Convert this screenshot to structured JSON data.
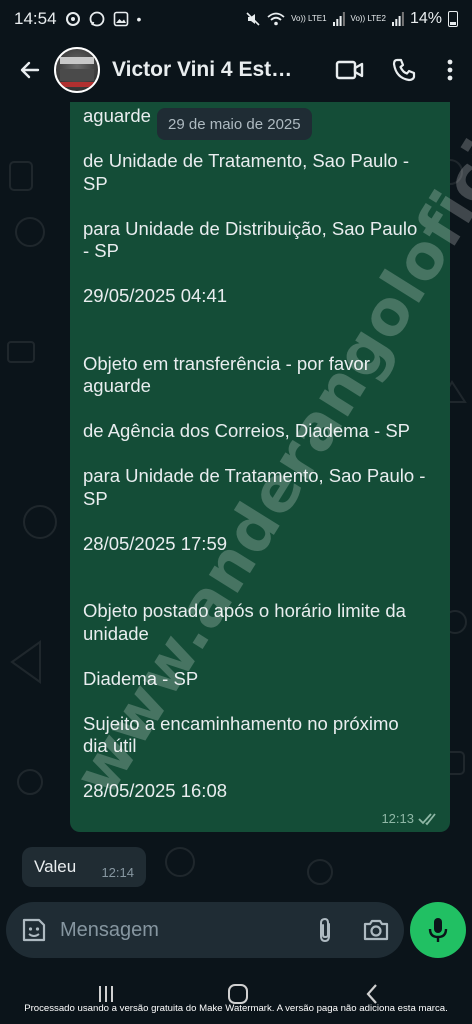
{
  "status_bar": {
    "time": "14:54",
    "net1": "Vo)) LTE1",
    "net2": "Vo)) LTE2",
    "battery": "14%"
  },
  "header": {
    "contact_name": "Victor Vini 4 Estre..."
  },
  "chat": {
    "date_chip": "29 de maio de 2025",
    "outgoing_message": "aguarde\n\nde Unidade de Tratamento, Sao Paulo -\nSP\n\npara Unidade de Distribuição, Sao Paulo\n- SP\n\n29/05/2025 04:41\n\n\nObjeto em transferência - por favor\naguarde\n\nde Agência dos Correios, Diadema - SP\n\npara Unidade de Tratamento, Sao Paulo -\nSP\n\n28/05/2025 17:59\n\n\nObjeto postado após o horário limite da\nunidade\n\nDiadema - SP\n\nSujeito a encaminhamento no próximo\ndia útil\n\n28/05/2025 16:08",
    "outgoing_time": "12:13",
    "incoming_message": "Valeu",
    "incoming_time": "12:14"
  },
  "composer": {
    "placeholder": "Mensagem"
  },
  "footer_note": "Processado usando a versão gratuita do Make Watermark. A versão paga não adiciona esta marca.",
  "watermark": "www.anderangoloficial.com.br",
  "colors": {
    "background": "#0b141a",
    "outgoing_bubble": "#144d37",
    "incoming_bubble": "#202c33",
    "accent_green": "#21c063",
    "read_ticks": "#8fb7a6"
  }
}
